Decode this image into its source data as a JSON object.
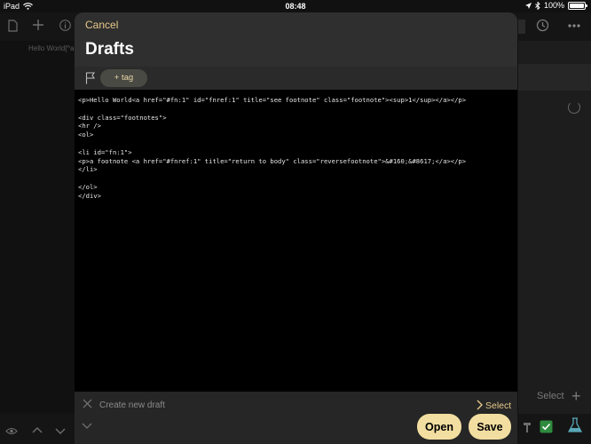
{
  "status_bar": {
    "device": "iPad",
    "time": "08:48",
    "battery": "100%"
  },
  "background": {
    "tab_text": "Hello World[^a",
    "select_label": "Select",
    "add_label": "+"
  },
  "sheet": {
    "cancel_label": "Cancel",
    "title": "Drafts",
    "tag_button_label": "+ tag",
    "editor_lines": [
      "<p>Hello World<a href=\"#fn:1\" id=\"fnref:1\" title=\"see footnote\" class=\"footnote\"><sup>1</sup></a></p>",
      "",
      "<div class=\"footnotes\">",
      "<hr />",
      "<ol>",
      "",
      "<li id=\"fn:1\">",
      "<p>a footnote <a href=\"#fnref:1\" title=\"return to body\" class=\"reversefootnote\">&#160;&#8617;</a></p>",
      "</li>",
      "",
      "</ol>",
      "</div>"
    ],
    "new_draft_placeholder": "Create new draft",
    "select_label": "Select",
    "open_label": "Open",
    "save_label": "Save"
  },
  "colors": {
    "accent": "#e6c98a",
    "button_fill": "#f2dea0",
    "editor_bg": "#000000",
    "sheet_bg": "#2c2c2c"
  }
}
